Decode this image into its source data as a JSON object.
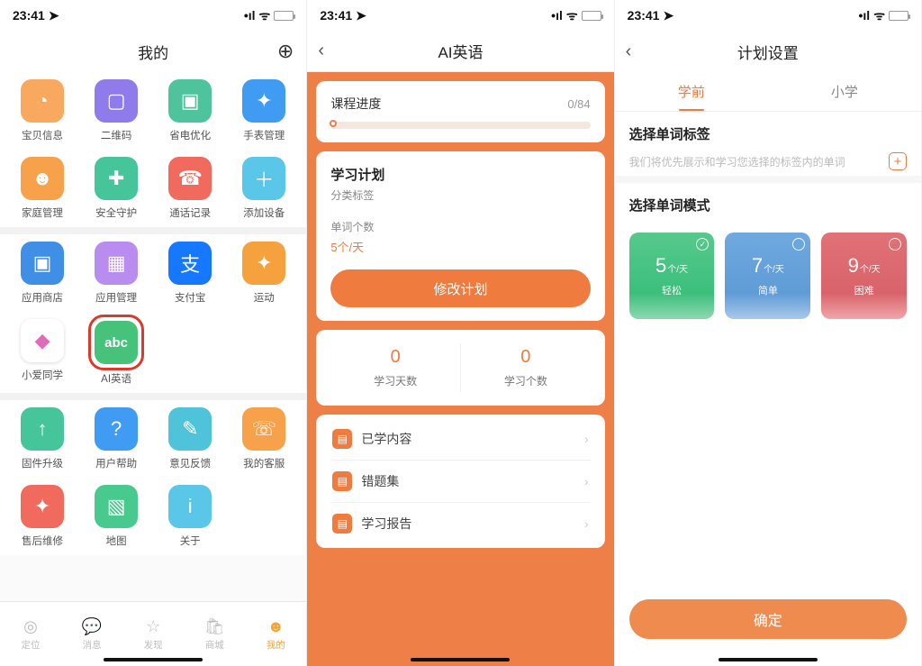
{
  "status": {
    "time": "23:41"
  },
  "screen1": {
    "title": "我的",
    "groups": [
      [
        {
          "label": "宝贝信息",
          "name": "baby-info",
          "bg": "#f9a85f",
          "glyph": "◔"
        },
        {
          "label": "二维码",
          "name": "qr-code",
          "bg": "#8f7bea",
          "glyph": "▢"
        },
        {
          "label": "省电优化",
          "name": "power-save",
          "bg": "#4fc49c",
          "glyph": "▣"
        },
        {
          "label": "手表管理",
          "name": "watch-mgmt",
          "bg": "#3f9cf2",
          "glyph": "✦"
        },
        {
          "label": "家庭管理",
          "name": "family-mgmt",
          "bg": "#f7a14b",
          "glyph": "☻"
        },
        {
          "label": "安全守护",
          "name": "safe-guard",
          "bg": "#46c49a",
          "glyph": "✚"
        },
        {
          "label": "通话记录",
          "name": "call-log",
          "bg": "#f06a5e",
          "glyph": "☎"
        },
        {
          "label": "添加设备",
          "name": "add-device",
          "bg": "#5ac7e8",
          "glyph": "＋"
        }
      ],
      [
        {
          "label": "应用商店",
          "name": "app-store",
          "bg": "#3f8fe6",
          "glyph": "▣"
        },
        {
          "label": "应用管理",
          "name": "app-mgmt",
          "bg": "#b98df0",
          "glyph": "▦"
        },
        {
          "label": "支付宝",
          "name": "alipay",
          "bg": "#1677ff",
          "glyph": "支"
        },
        {
          "label": "运动",
          "name": "sport",
          "bg": "#f5a13d",
          "glyph": "✦"
        },
        {
          "label": "小爱同学",
          "name": "xiaoai",
          "bg": "#ffffff",
          "glyph": "◆",
          "fg": "#e06bb6"
        },
        {
          "label": "AI英语",
          "name": "ai-english",
          "bg": "#47c27a",
          "glyph": "abc",
          "hl": true
        }
      ],
      [
        {
          "label": "固件升级",
          "name": "firmware",
          "bg": "#46c49a",
          "glyph": "↑"
        },
        {
          "label": "用户帮助",
          "name": "help",
          "bg": "#3f9cf2",
          "glyph": "?"
        },
        {
          "label": "意见反馈",
          "name": "feedback",
          "bg": "#4fc3d9",
          "glyph": "✎"
        },
        {
          "label": "我的客服",
          "name": "support",
          "bg": "#f7a14b",
          "glyph": "☏"
        },
        {
          "label": "售后维修",
          "name": "repair",
          "bg": "#f06a5e",
          "glyph": "✦"
        },
        {
          "label": "地图",
          "name": "map",
          "bg": "#48c98d",
          "glyph": "▧"
        },
        {
          "label": "关于",
          "name": "about",
          "bg": "#5ac7e8",
          "glyph": "i"
        }
      ]
    ],
    "tabs": [
      {
        "label": "定位",
        "name": "tab-locate",
        "glyph": "◎"
      },
      {
        "label": "消息",
        "name": "tab-msg",
        "glyph": "💬"
      },
      {
        "label": "发现",
        "name": "tab-discover",
        "glyph": "☆"
      },
      {
        "label": "商城",
        "name": "tab-shop",
        "glyph": "🛍"
      },
      {
        "label": "我的",
        "name": "tab-mine",
        "glyph": "☻",
        "active": true
      }
    ]
  },
  "screen2": {
    "title": "AI英语",
    "progress": {
      "label": "课程进度",
      "value": "0/84"
    },
    "plan": {
      "title": "学习计划",
      "sub": "分类标签",
      "count_label": "单词个数",
      "count_value": "5个/天",
      "button": "修改计划"
    },
    "stats": [
      {
        "num": "0",
        "label": "学习天数"
      },
      {
        "num": "0",
        "label": "学习个数"
      }
    ],
    "menu": [
      {
        "label": "已学内容",
        "name": "learned"
      },
      {
        "label": "错题集",
        "name": "wrong-set"
      },
      {
        "label": "学习报告",
        "name": "report"
      }
    ]
  },
  "screen3": {
    "title": "计划设置",
    "tabs": [
      {
        "label": "学前",
        "active": true
      },
      {
        "label": "小学",
        "active": false
      }
    ],
    "sec_tag": {
      "title": "选择单词标签",
      "sub": "我们将优先展示和学习您选择的标签内的单词"
    },
    "sec_mode": {
      "title": "选择单词模式"
    },
    "modes": [
      {
        "num": "5",
        "per": "个/天",
        "tag": "轻松",
        "cls": "green",
        "checked": true
      },
      {
        "num": "7",
        "per": "个/天",
        "tag": "简单",
        "cls": "blue",
        "checked": false
      },
      {
        "num": "9",
        "per": "个/天",
        "tag": "困难",
        "cls": "red",
        "checked": false
      }
    ],
    "confirm": "确定"
  }
}
